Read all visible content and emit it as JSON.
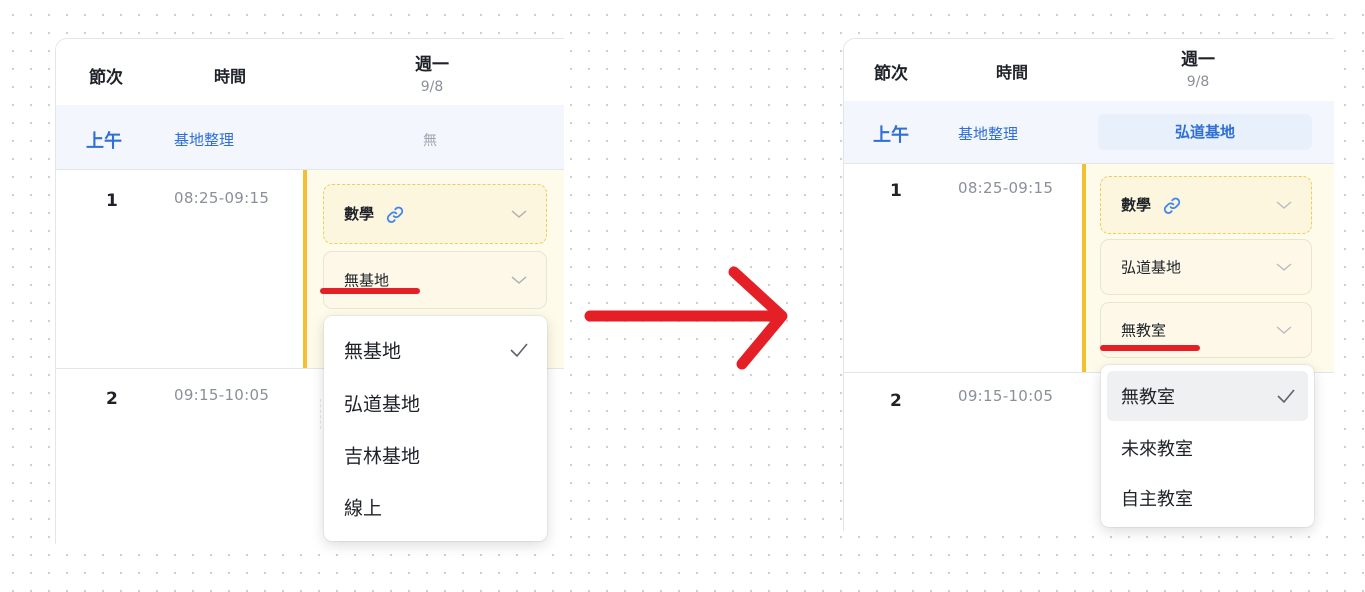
{
  "left_panel": {
    "header": {
      "period": "節次",
      "time": "時間",
      "day": "週一",
      "date": "9/8"
    },
    "morning": {
      "label": "上午",
      "site_link": "基地整理",
      "value": "無"
    },
    "periods": [
      {
        "number": "1",
        "time": "08:25-09:15"
      },
      {
        "number": "2",
        "time": "09:15-10:05"
      }
    ],
    "subject_select": {
      "value": "數學",
      "icon": "link-icon"
    },
    "base_select": {
      "value": "無基地",
      "icon": "chevron-down-icon"
    },
    "base_menu": {
      "options": [
        "無基地",
        "弘道基地",
        "吉林基地",
        "線上"
      ],
      "selected": "無基地"
    }
  },
  "right_panel": {
    "header": {
      "period": "節次",
      "time": "時間",
      "day": "週一",
      "date": "9/8"
    },
    "morning": {
      "label": "上午",
      "site_link": "基地整理",
      "value": "弘道基地"
    },
    "periods": [
      {
        "number": "1",
        "time": "08:25-09:15"
      },
      {
        "number": "2",
        "time": "09:15-10:05"
      }
    ],
    "subject_select": {
      "value": "數學",
      "icon": "link-icon"
    },
    "base_select": {
      "value": "弘道基地"
    },
    "classroom_select": {
      "value": "無教室"
    },
    "classroom_menu": {
      "options": [
        "無教室",
        "未來教室",
        "自主教室"
      ],
      "selected": "無教室"
    }
  },
  "annotations": {
    "arrow": "red-arrow-icon",
    "underline_color": "#e51f26",
    "accent_color": "#2f6fd6",
    "slot_bar_color": "#f3c035"
  }
}
